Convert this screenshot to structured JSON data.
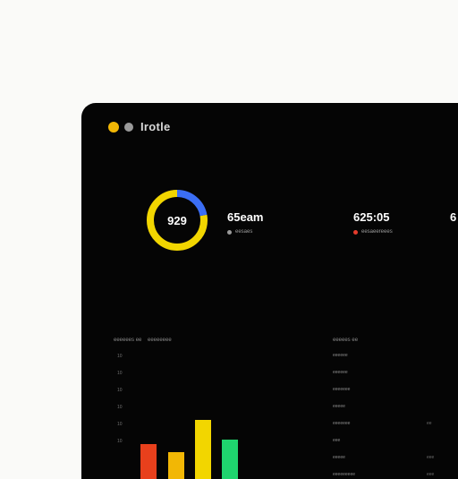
{
  "window": {
    "title": "Irotle"
  },
  "donut": {
    "center_label": "929",
    "segments": [
      {
        "name": "primary",
        "fraction": 0.78,
        "color": "#f2d600"
      },
      {
        "name": "secondary",
        "fraction": 0.22,
        "color": "#3b6ef5"
      }
    ]
  },
  "stats": [
    {
      "value": "65eam",
      "sub_label": "eesaes",
      "dot_color": "#9a9a9a"
    },
    {
      "value": "625:05",
      "sub_label": "eesaeereees",
      "dot_color": "#e53b2c"
    },
    {
      "value": "6",
      "sub_label": "",
      "dot_color": ""
    }
  ],
  "left_panel": {
    "headings": [
      "eeeeees ee",
      "eeeeeeee"
    ],
    "y_ticks": [
      "10",
      "10",
      "10",
      "10",
      "10",
      "10"
    ],
    "bars": [
      {
        "value": 0.55,
        "color": "#e8401c"
      },
      {
        "value": 0.45,
        "color": "#f2b705"
      },
      {
        "value": 0.85,
        "color": "#f2d600"
      },
      {
        "value": 0.6,
        "color": "#1fd46e"
      }
    ]
  },
  "right_panel": {
    "heading": "eeeees ee",
    "rows": [
      "eeeeee",
      "eeeeee",
      "eeeeeee",
      "eeeee",
      "eeeeeee",
      "eee",
      "eeeee",
      "eeeeeeeee"
    ],
    "row_values": [
      "",
      "",
      "",
      "",
      "ee",
      "",
      "eee",
      "eee"
    ]
  }
}
